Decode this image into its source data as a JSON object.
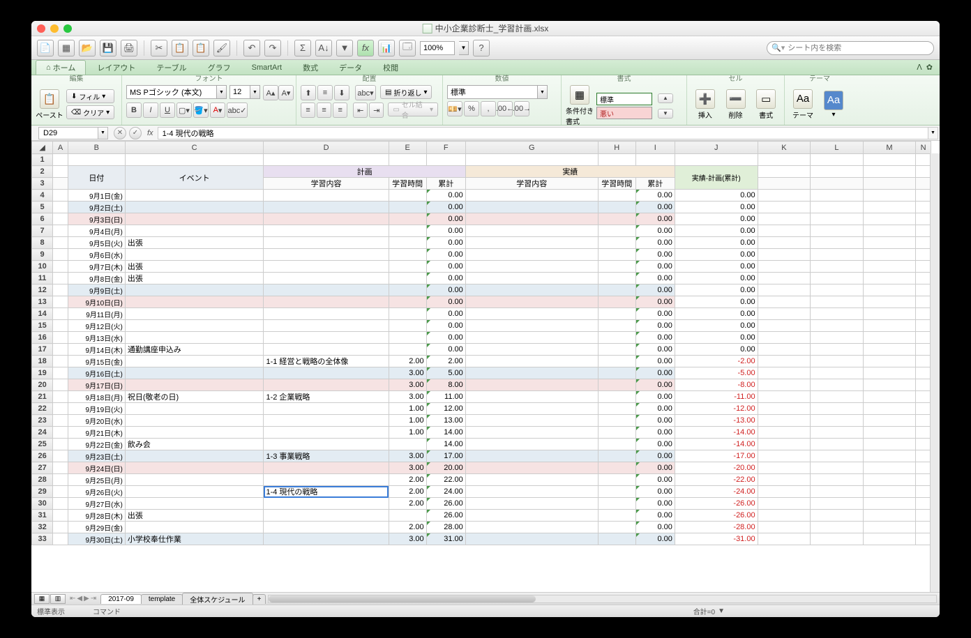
{
  "window": {
    "title": "中小企業診断士_学習計画.xlsx"
  },
  "toolbar": {
    "zoom": "100%",
    "search_placeholder": "シート内を検索"
  },
  "ribbon": {
    "tabs": [
      "ホーム",
      "レイアウト",
      "テーブル",
      "グラフ",
      "SmartArt",
      "数式",
      "データ",
      "校閲"
    ],
    "groups": {
      "edit": "編集",
      "font": "フォント",
      "align": "配置",
      "number": "数値",
      "format": "書式",
      "cell": "セル",
      "theme": "テーマ"
    },
    "paste": "ペースト",
    "fill": "フィル",
    "clear": "クリア",
    "font_name": "MS Pゴシック (本文)",
    "font_size": "12",
    "wrap": "折り返し",
    "merge": "セル結合",
    "num_format": "標準",
    "cond_format": "条件付き書式",
    "style_normal": "標準",
    "style_bad": "悪い",
    "insert": "挿入",
    "delete": "削除",
    "format_btn": "書式",
    "theme_btn": "テーマ"
  },
  "formula": {
    "cell_ref": "D29",
    "content": "1-4 現代の戦略"
  },
  "columns": [
    "A",
    "B",
    "C",
    "D",
    "E",
    "F",
    "G",
    "H",
    "I",
    "J",
    "K",
    "L",
    "M",
    "N"
  ],
  "headers": {
    "date": "日付",
    "event": "イベント",
    "plan": "計画",
    "actual": "実績",
    "diff": "実績-計画(累計)",
    "study": "学習内容",
    "hours": "学習時間",
    "cum": "累計"
  },
  "rows": [
    {
      "r": 4,
      "date": "9月1日(金)",
      "event": "",
      "pc": "",
      "ph": "",
      "cum": "0.00",
      "ac": "",
      "ah": "",
      "acum": "0.00",
      "diff": "0.00",
      "cls": ""
    },
    {
      "r": 5,
      "date": "9月2日(土)",
      "event": "",
      "pc": "",
      "ph": "",
      "cum": "0.00",
      "ac": "",
      "ah": "",
      "acum": "0.00",
      "diff": "0.00",
      "cls": "sat"
    },
    {
      "r": 6,
      "date": "9月3日(日)",
      "event": "",
      "pc": "",
      "ph": "",
      "cum": "0.00",
      "ac": "",
      "ah": "",
      "acum": "0.00",
      "diff": "0.00",
      "cls": "sun"
    },
    {
      "r": 7,
      "date": "9月4日(月)",
      "event": "",
      "pc": "",
      "ph": "",
      "cum": "0.00",
      "ac": "",
      "ah": "",
      "acum": "0.00",
      "diff": "0.00",
      "cls": ""
    },
    {
      "r": 8,
      "date": "9月5日(火)",
      "event": "出張",
      "pc": "",
      "ph": "",
      "cum": "0.00",
      "ac": "",
      "ah": "",
      "acum": "0.00",
      "diff": "0.00",
      "cls": ""
    },
    {
      "r": 9,
      "date": "9月6日(水)",
      "event": "",
      "pc": "",
      "ph": "",
      "cum": "0.00",
      "ac": "",
      "ah": "",
      "acum": "0.00",
      "diff": "0.00",
      "cls": ""
    },
    {
      "r": 10,
      "date": "9月7日(木)",
      "event": "出張",
      "pc": "",
      "ph": "",
      "cum": "0.00",
      "ac": "",
      "ah": "",
      "acum": "0.00",
      "diff": "0.00",
      "cls": ""
    },
    {
      "r": 11,
      "date": "9月8日(金)",
      "event": "出張",
      "pc": "",
      "ph": "",
      "cum": "0.00",
      "ac": "",
      "ah": "",
      "acum": "0.00",
      "diff": "0.00",
      "cls": ""
    },
    {
      "r": 12,
      "date": "9月9日(土)",
      "event": "",
      "pc": "",
      "ph": "",
      "cum": "0.00",
      "ac": "",
      "ah": "",
      "acum": "0.00",
      "diff": "0.00",
      "cls": "sat"
    },
    {
      "r": 13,
      "date": "9月10日(日)",
      "event": "",
      "pc": "",
      "ph": "",
      "cum": "0.00",
      "ac": "",
      "ah": "",
      "acum": "0.00",
      "diff": "0.00",
      "cls": "sun"
    },
    {
      "r": 14,
      "date": "9月11日(月)",
      "event": "",
      "pc": "",
      "ph": "",
      "cum": "0.00",
      "ac": "",
      "ah": "",
      "acum": "0.00",
      "diff": "0.00",
      "cls": ""
    },
    {
      "r": 15,
      "date": "9月12日(火)",
      "event": "",
      "pc": "",
      "ph": "",
      "cum": "0.00",
      "ac": "",
      "ah": "",
      "acum": "0.00",
      "diff": "0.00",
      "cls": ""
    },
    {
      "r": 16,
      "date": "9月13日(水)",
      "event": "",
      "pc": "",
      "ph": "",
      "cum": "0.00",
      "ac": "",
      "ah": "",
      "acum": "0.00",
      "diff": "0.00",
      "cls": ""
    },
    {
      "r": 17,
      "date": "9月14日(木)",
      "event": "通勤講座申込み",
      "pc": "",
      "ph": "",
      "cum": "0.00",
      "ac": "",
      "ah": "",
      "acum": "0.00",
      "diff": "0.00",
      "cls": ""
    },
    {
      "r": 18,
      "date": "9月15日(金)",
      "event": "",
      "pc": "1-1 経営と戦略の全体像",
      "ph": "2.00",
      "cum": "2.00",
      "ac": "",
      "ah": "",
      "acum": "0.00",
      "diff": "-2.00",
      "cls": ""
    },
    {
      "r": 19,
      "date": "9月16日(土)",
      "event": "",
      "pc": "",
      "ph": "3.00",
      "cum": "5.00",
      "ac": "",
      "ah": "",
      "acum": "0.00",
      "diff": "-5.00",
      "cls": "sat"
    },
    {
      "r": 20,
      "date": "9月17日(日)",
      "event": "",
      "pc": "",
      "ph": "3.00",
      "cum": "8.00",
      "ac": "",
      "ah": "",
      "acum": "0.00",
      "diff": "-8.00",
      "cls": "sun"
    },
    {
      "r": 21,
      "date": "9月18日(月)",
      "event": "祝日(敬老の日)",
      "pc": "1-2 企業戦略",
      "ph": "3.00",
      "cum": "11.00",
      "ac": "",
      "ah": "",
      "acum": "0.00",
      "diff": "-11.00",
      "cls": ""
    },
    {
      "r": 22,
      "date": "9月19日(火)",
      "event": "",
      "pc": "",
      "ph": "1.00",
      "cum": "12.00",
      "ac": "",
      "ah": "",
      "acum": "0.00",
      "diff": "-12.00",
      "cls": ""
    },
    {
      "r": 23,
      "date": "9月20日(水)",
      "event": "",
      "pc": "",
      "ph": "1.00",
      "cum": "13.00",
      "ac": "",
      "ah": "",
      "acum": "0.00",
      "diff": "-13.00",
      "cls": ""
    },
    {
      "r": 24,
      "date": "9月21日(木)",
      "event": "",
      "pc": "",
      "ph": "1.00",
      "cum": "14.00",
      "ac": "",
      "ah": "",
      "acum": "0.00",
      "diff": "-14.00",
      "cls": ""
    },
    {
      "r": 25,
      "date": "9月22日(金)",
      "event": "飲み会",
      "pc": "",
      "ph": "",
      "cum": "14.00",
      "ac": "",
      "ah": "",
      "acum": "0.00",
      "diff": "-14.00",
      "cls": ""
    },
    {
      "r": 26,
      "date": "9月23日(土)",
      "event": "",
      "pc": "1-3 事業戦略",
      "ph": "3.00",
      "cum": "17.00",
      "ac": "",
      "ah": "",
      "acum": "0.00",
      "diff": "-17.00",
      "cls": "sat"
    },
    {
      "r": 27,
      "date": "9月24日(日)",
      "event": "",
      "pc": "",
      "ph": "3.00",
      "cum": "20.00",
      "ac": "",
      "ah": "",
      "acum": "0.00",
      "diff": "-20.00",
      "cls": "sun"
    },
    {
      "r": 28,
      "date": "9月25日(月)",
      "event": "",
      "pc": "",
      "ph": "2.00",
      "cum": "22.00",
      "ac": "",
      "ah": "",
      "acum": "0.00",
      "diff": "-22.00",
      "cls": ""
    },
    {
      "r": 29,
      "date": "9月26日(火)",
      "event": "",
      "pc": "1-4 現代の戦略",
      "ph": "2.00",
      "cum": "24.00",
      "ac": "",
      "ah": "",
      "acum": "0.00",
      "diff": "-24.00",
      "cls": "",
      "sel": true
    },
    {
      "r": 30,
      "date": "9月27日(水)",
      "event": "",
      "pc": "",
      "ph": "2.00",
      "cum": "26.00",
      "ac": "",
      "ah": "",
      "acum": "0.00",
      "diff": "-26.00",
      "cls": ""
    },
    {
      "r": 31,
      "date": "9月28日(木)",
      "event": "出張",
      "pc": "",
      "ph": "",
      "cum": "26.00",
      "ac": "",
      "ah": "",
      "acum": "0.00",
      "diff": "-26.00",
      "cls": ""
    },
    {
      "r": 32,
      "date": "9月29日(金)",
      "event": "",
      "pc": "",
      "ph": "2.00",
      "cum": "28.00",
      "ac": "",
      "ah": "",
      "acum": "0.00",
      "diff": "-28.00",
      "cls": ""
    },
    {
      "r": 33,
      "date": "9月30日(土)",
      "event": "小学校奉仕作業",
      "pc": "",
      "ph": "3.00",
      "cum": "31.00",
      "ac": "",
      "ah": "",
      "acum": "0.00",
      "diff": "-31.00",
      "cls": "sat"
    }
  ],
  "sheet_tabs": [
    "2017-09",
    "template",
    "全体スケジュール"
  ],
  "status": {
    "mode": "標準表示",
    "cmd": "コマンド",
    "sum": "合計=0"
  }
}
